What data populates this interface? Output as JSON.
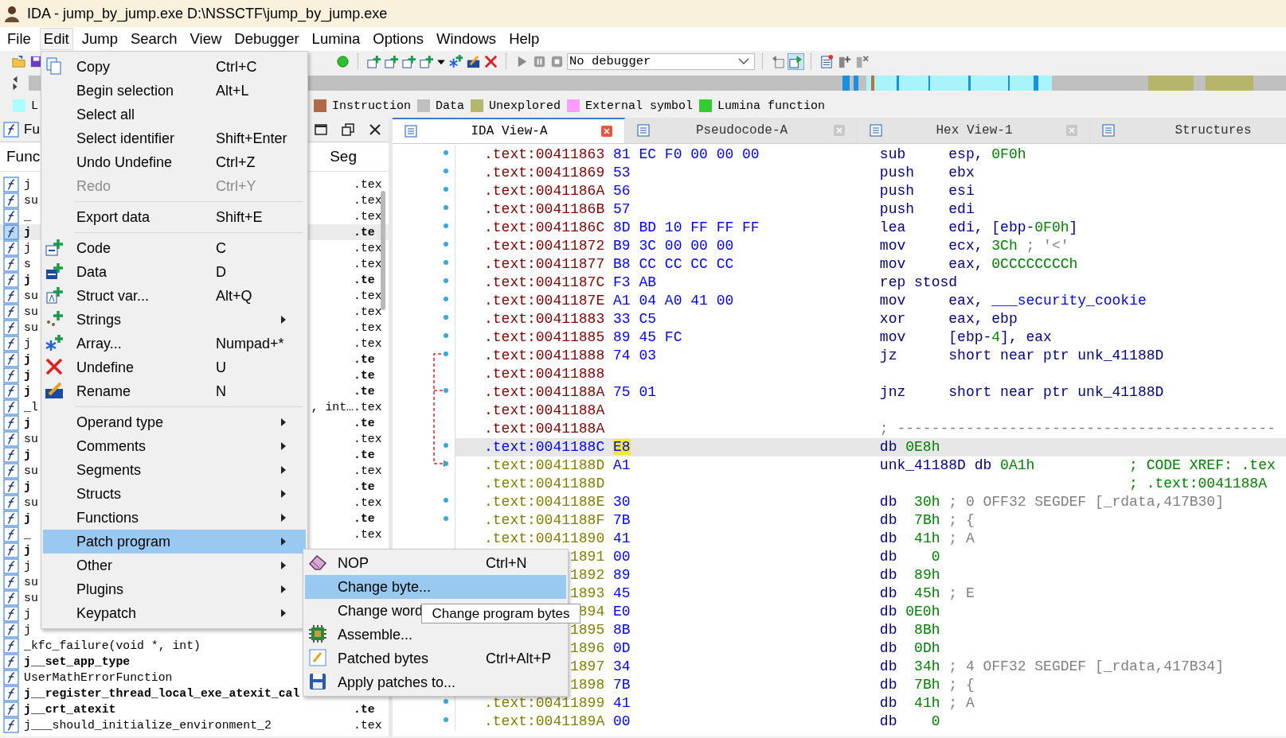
{
  "window": {
    "title": "IDA - jump_by_jump.exe D:\\NSSCTF\\jump_by_jump.exe"
  },
  "menu_bar": [
    {
      "label": "File",
      "selected": false
    },
    {
      "label": "Edit",
      "selected": true
    },
    {
      "label": "Jump",
      "selected": false
    },
    {
      "label": "Search",
      "selected": false
    },
    {
      "label": "View",
      "selected": false
    },
    {
      "label": "Debugger",
      "selected": false
    },
    {
      "label": "Lumina",
      "selected": false
    },
    {
      "label": "Options",
      "selected": false
    },
    {
      "label": "Windows",
      "selected": false
    },
    {
      "label": "Help",
      "selected": false
    }
  ],
  "toolbar": {
    "debugger_select": "No debugger"
  },
  "legend": [
    {
      "label": "L",
      "color": "#aaffff"
    },
    {
      "label": "Instruction",
      "color": "#b06a4a"
    },
    {
      "label": "Data",
      "color": "#c0c0c0"
    },
    {
      "label": "Unexplored",
      "color": "#b5b56c"
    },
    {
      "label": "External symbol",
      "color": "#ff9eff"
    },
    {
      "label": "Lumina function",
      "color": "#33cc33"
    }
  ],
  "functions_panel": {
    "title": "Fu",
    "columns": [
      "Func",
      "Seg"
    ],
    "rows": [
      {
        "name": "j",
        "bold": false,
        "selected": false,
        "segment": ".tex"
      },
      {
        "name": "su",
        "bold": false,
        "selected": false,
        "segment": ".tex"
      },
      {
        "name": "_",
        "selected": false,
        "segment": ".tex"
      },
      {
        "name": "j",
        "bold": true,
        "selected": true,
        "segment": ".te"
      },
      {
        "name": "j",
        "bold": false,
        "selected": false,
        "segment": ".tex"
      },
      {
        "name": "s",
        "bold": false,
        "selected": false,
        "segment": ".tex"
      },
      {
        "name": "j",
        "bold": true,
        "selected": false,
        "segment": ".te"
      },
      {
        "name": "su",
        "bold": false,
        "selected": false,
        "segment": ".tex"
      },
      {
        "name": "su",
        "bold": false,
        "selected": false,
        "segment": ".tex"
      },
      {
        "name": "su",
        "bold": false,
        "selected": false,
        "segment": ".tex"
      },
      {
        "name": "j",
        "bold": false,
        "selected": false,
        "segment": ".tex"
      },
      {
        "name": "j",
        "bold": true,
        "selected": false,
        "segment": ".te"
      },
      {
        "name": "j",
        "bold": true,
        "selected": false,
        "segment": ".te"
      },
      {
        "name": "j",
        "bold": true,
        "selected": false,
        "segment": ".te"
      },
      {
        "name": "_l",
        "bold": false,
        "selected": false,
        "tail": ", int…",
        "segment": ".tex"
      },
      {
        "name": "j",
        "bold": true,
        "selected": false,
        "segment": ".te"
      },
      {
        "name": "su",
        "bold": false,
        "selected": false,
        "segment": ".tex"
      },
      {
        "name": "j",
        "bold": true,
        "selected": false,
        "segment": ".te"
      },
      {
        "name": "su",
        "bold": false,
        "selected": false,
        "segment": ".tex"
      },
      {
        "name": "j",
        "bold": true,
        "selected": false,
        "segment": ".te"
      },
      {
        "name": "su",
        "bold": false,
        "selected": false,
        "segment": ".tex"
      },
      {
        "name": "j",
        "bold": true,
        "selected": false,
        "segment": ".te"
      },
      {
        "name": "_",
        "selected": false,
        "segment": ".tex"
      },
      {
        "name": "j",
        "bold": true,
        "selected": false
      },
      {
        "name": "j",
        "bold": false,
        "selected": false
      },
      {
        "name": "su",
        "bold": false,
        "selected": false
      },
      {
        "name": "su",
        "bold": false,
        "selected": false
      },
      {
        "name": "j",
        "bold": false,
        "selected": false
      },
      {
        "name": "j",
        "bold": false,
        "selected": false
      },
      {
        "name": "_kfc_failure(void *, int)",
        "bold": false,
        "selected": false
      },
      {
        "name": "j__set_app_type",
        "bold": true,
        "selected": false
      },
      {
        "name": "UserMathErrorFunction",
        "bold": false,
        "selected": false
      },
      {
        "name": "j__register_thread_local_exe_atexit_cal",
        "bold": true,
        "selected": false
      },
      {
        "name": "j__crt_atexit",
        "bold": true,
        "selected": false,
        "segment": ".te"
      },
      {
        "name": "j___should_initialize_environment_2",
        "bold": false,
        "selected": false,
        "segment": ".tex"
      }
    ]
  },
  "disassembly": {
    "tabs": [
      {
        "label": "IDA View-A",
        "selected": true
      },
      {
        "label": "Pseudocode-A",
        "selected": false
      },
      {
        "label": "Hex View-1",
        "selected": false
      },
      {
        "label": "Structures",
        "selected": false
      }
    ],
    "rows": [
      {
        "address": ".text:00411863",
        "kind": "code",
        "marked": true,
        "selected": false,
        "bytes": "81 EC F0 00 00 00",
        "code": [
          {
            "text": "sub     esp, ",
            "kind": "plain"
          },
          {
            "text": "0F0h",
            "kind": "num"
          }
        ]
      },
      {
        "address": ".text:00411869",
        "kind": "code",
        "marked": true,
        "selected": false,
        "bytes": "53",
        "code": [
          {
            "text": "push    ebx",
            "kind": "plain"
          }
        ]
      },
      {
        "address": ".text:0041186A",
        "kind": "code",
        "marked": true,
        "selected": false,
        "bytes": "56",
        "code": [
          {
            "text": "push    esi",
            "kind": "plain"
          }
        ]
      },
      {
        "address": ".text:0041186B",
        "kind": "code",
        "marked": true,
        "selected": false,
        "bytes": "57",
        "code": [
          {
            "text": "push    edi",
            "kind": "plain"
          }
        ]
      },
      {
        "address": ".text:0041186C",
        "kind": "code",
        "marked": true,
        "selected": false,
        "bytes": "8D BD 10 FF FF FF",
        "code": [
          {
            "text": "lea     edi, [ebp-",
            "kind": "plain"
          },
          {
            "text": "0F0h",
            "kind": "num"
          },
          {
            "text": "]",
            "kind": "plain"
          }
        ]
      },
      {
        "address": ".text:00411872",
        "kind": "code",
        "marked": true,
        "selected": false,
        "bytes": "B9 3C 00 00 00",
        "code": [
          {
            "text": "mov     ecx, ",
            "kind": "plain"
          },
          {
            "text": "3Ch",
            "kind": "num"
          },
          {
            "text": " ; '<'",
            "kind": "cmt"
          }
        ]
      },
      {
        "address": ".text:00411877",
        "kind": "code",
        "marked": true,
        "selected": false,
        "bytes": "B8 CC CC CC CC",
        "code": [
          {
            "text": "mov     eax, ",
            "kind": "plain"
          },
          {
            "text": "0CCCCCCCCh",
            "kind": "num"
          }
        ]
      },
      {
        "address": ".text:0041187C",
        "kind": "code",
        "marked": true,
        "selected": false,
        "bytes": "F3 AB",
        "code": [
          {
            "text": "rep stosd",
            "kind": "plain"
          }
        ]
      },
      {
        "address": ".text:0041187E",
        "kind": "code",
        "marked": true,
        "selected": false,
        "bytes": "A1 04 A0 41 00",
        "code": [
          {
            "text": "mov     eax, ",
            "kind": "plain"
          },
          {
            "text": "___security_cookie",
            "kind": "sym"
          }
        ]
      },
      {
        "address": ".text:00411883",
        "kind": "code",
        "marked": true,
        "selected": false,
        "bytes": "33 C5",
        "code": [
          {
            "text": "xor     eax, ebp",
            "kind": "plain"
          }
        ]
      },
      {
        "address": ".text:00411885",
        "kind": "code",
        "marked": true,
        "selected": false,
        "bytes": "89 45 FC",
        "code": [
          {
            "text": "mov     [ebp-",
            "kind": "plain"
          },
          {
            "text": "4",
            "kind": "num"
          },
          {
            "text": "], eax",
            "kind": "plain"
          }
        ]
      },
      {
        "address": ".text:00411888",
        "kind": "code",
        "marked": true,
        "selected": false,
        "bytes": "74 03",
        "code": [
          {
            "text": "jz      short near ptr unk_41188D",
            "kind": "plain"
          }
        ]
      },
      {
        "address": ".text:00411888",
        "kind": "code",
        "marked": false,
        "selected": false
      },
      {
        "address": ".text:0041188A",
        "kind": "code",
        "marked": true,
        "selected": false,
        "bytes": "75 01",
        "code": [
          {
            "text": "jnz     short near ptr unk_41188D",
            "kind": "plain"
          }
        ]
      },
      {
        "address": ".text:0041188A",
        "kind": "code",
        "marked": false,
        "selected": false
      },
      {
        "address": ".text:0041188A",
        "kind": "code",
        "marked": false,
        "selected": false,
        "code": [
          {
            "text": "; --------------------------------------------",
            "kind": "cmt"
          }
        ]
      },
      {
        "address": ".text:0041188C",
        "kind": "data",
        "marked": true,
        "selected": true,
        "bytes": "E8",
        "code": [
          {
            "text": "db ",
            "kind": "plain"
          },
          {
            "text": "0E8h",
            "kind": "num"
          }
        ]
      },
      {
        "address": ".text:0041188D",
        "kind": "data",
        "marked": true,
        "selected": false,
        "bytes": "A1",
        "code": [
          {
            "text": "unk_41188D db ",
            "kind": "plain"
          },
          {
            "text": "0A1h",
            "kind": "num"
          }
        ],
        "xref": "; CODE XREF: .tex"
      },
      {
        "address": ".text:0041188D",
        "kind": "data",
        "marked": false,
        "selected": false,
        "xref": "; .text:0041188A"
      },
      {
        "address": ".text:0041188E",
        "kind": "data",
        "marked": true,
        "selected": false,
        "bytes": "30",
        "code": [
          {
            "text": "db  ",
            "kind": "plain"
          },
          {
            "text": "30h",
            "kind": "num"
          },
          {
            "text": " ; 0 OFF32 SEGDEF [_rdata,417B30]",
            "kind": "cmt"
          }
        ]
      },
      {
        "address": ".text:0041188F",
        "kind": "data",
        "marked": true,
        "selected": false,
        "bytes": "7B",
        "code": [
          {
            "text": "db  ",
            "kind": "plain"
          },
          {
            "text": "7Bh",
            "kind": "num"
          },
          {
            "text": " ; {",
            "kind": "cmt"
          }
        ]
      },
      {
        "address": ".text:00411890",
        "kind": "data",
        "marked": false,
        "selected": false,
        "bytes": "41",
        "code": [
          {
            "text": "db  ",
            "kind": "plain"
          },
          {
            "text": "41h",
            "kind": "num"
          },
          {
            "text": " ; A",
            "kind": "cmt"
          }
        ]
      },
      {
        "address": "1891",
        "kind": "data",
        "marked": false,
        "selected": false,
        "bytes": "00",
        "code": [
          {
            "text": "db    ",
            "kind": "plain"
          },
          {
            "text": "0",
            "kind": "num"
          }
        ]
      },
      {
        "address": "1892",
        "kind": "data",
        "marked": false,
        "selected": false,
        "bytes": "89",
        "code": [
          {
            "text": "db  ",
            "kind": "plain"
          },
          {
            "text": "89h",
            "kind": "num"
          }
        ]
      },
      {
        "address": "1893",
        "kind": "data",
        "marked": false,
        "selected": false,
        "bytes": "45",
        "code": [
          {
            "text": "db  ",
            "kind": "plain"
          },
          {
            "text": "45h",
            "kind": "num"
          },
          {
            "text": " ; E",
            "kind": "cmt"
          }
        ]
      },
      {
        "address": "894",
        "kind": "data",
        "marked": false,
        "selected": false,
        "bytes": "E0",
        "code": [
          {
            "text": "db ",
            "kind": "plain"
          },
          {
            "text": "0E0h",
            "kind": "num"
          }
        ]
      },
      {
        "address": "1895",
        "kind": "data",
        "marked": false,
        "selected": false,
        "bytes": "8B",
        "code": [
          {
            "text": "db  ",
            "kind": "plain"
          },
          {
            "text": "8Bh",
            "kind": "num"
          }
        ]
      },
      {
        "address": "1896",
        "kind": "data",
        "marked": false,
        "selected": false,
        "bytes": "0D",
        "code": [
          {
            "text": "db  ",
            "kind": "plain"
          },
          {
            "text": "0Dh",
            "kind": "num"
          }
        ]
      },
      {
        "address": "1897",
        "kind": "data",
        "marked": false,
        "selected": false,
        "bytes": "34",
        "code": [
          {
            "text": "db  ",
            "kind": "plain"
          },
          {
            "text": "34h",
            "kind": "num"
          },
          {
            "text": " ; 4 OFF32 SEGDEF [_rdata,417B34]",
            "kind": "cmt"
          }
        ]
      },
      {
        "address": "1898",
        "kind": "data",
        "marked": false,
        "selected": false,
        "bytes": "7B",
        "code": [
          {
            "text": "db  ",
            "kind": "plain"
          },
          {
            "text": "7Bh",
            "kind": "num"
          },
          {
            "text": " ; {",
            "kind": "cmt"
          }
        ]
      },
      {
        "address": ".text:00411899",
        "kind": "data",
        "marked": true,
        "selected": false,
        "bytes": "41",
        "code": [
          {
            "text": "db  ",
            "kind": "plain"
          },
          {
            "text": "41h",
            "kind": "num"
          },
          {
            "text": " ; A",
            "kind": "cmt"
          }
        ]
      },
      {
        "address": ".text:0041189A",
        "kind": "data",
        "marked": true,
        "selected": false,
        "bytes": "00",
        "code": [
          {
            "text": "db    ",
            "kind": "plain"
          },
          {
            "text": "0",
            "kind": "num"
          }
        ]
      }
    ]
  },
  "edit_menu": {
    "items": [
      {
        "kind": "item",
        "label": "Copy",
        "shortcut": "Ctrl+C",
        "submenu": false,
        "disabled": false,
        "selected": false
      },
      {
        "kind": "item",
        "label": "Begin selection",
        "shortcut": "Alt+L",
        "submenu": false,
        "disabled": false,
        "selected": false
      },
      {
        "kind": "item",
        "label": "Select all",
        "submenu": false,
        "disabled": false,
        "selected": false
      },
      {
        "kind": "item",
        "label": "Select identifier",
        "shortcut": "Shift+Enter",
        "submenu": false,
        "disabled": false,
        "selected": false
      },
      {
        "kind": "item",
        "label": "Undo Undefine",
        "shortcut": "Ctrl+Z",
        "submenu": false,
        "disabled": false,
        "selected": false
      },
      {
        "kind": "item",
        "label": "Redo",
        "shortcut": "Ctrl+Y",
        "submenu": false,
        "disabled": true,
        "selected": false
      },
      {
        "kind": "separator"
      },
      {
        "kind": "item",
        "label": "Export data",
        "shortcut": "Shift+E",
        "submenu": false,
        "disabled": false,
        "selected": false
      },
      {
        "kind": "separator"
      },
      {
        "kind": "item",
        "label": "Code",
        "shortcut": "C",
        "submenu": false,
        "disabled": false,
        "selected": false
      },
      {
        "kind": "item",
        "label": "Data",
        "shortcut": "D",
        "submenu": false,
        "disabled": false,
        "selected": false
      },
      {
        "kind": "item",
        "label": "Struct var...",
        "shortcut": "Alt+Q",
        "submenu": false,
        "disabled": false,
        "selected": false
      },
      {
        "kind": "item",
        "label": "Strings",
        "submenu": true,
        "disabled": false,
        "selected": false
      },
      {
        "kind": "item",
        "label": "Array...",
        "shortcut": "Numpad+*",
        "submenu": false,
        "disabled": false,
        "selected": false
      },
      {
        "kind": "item",
        "label": "Undefine",
        "shortcut": "U",
        "submenu": false,
        "disabled": false,
        "selected": false
      },
      {
        "kind": "item",
        "label": "Rename",
        "shortcut": "N",
        "submenu": false,
        "disabled": false,
        "selected": false
      },
      {
        "kind": "separator"
      },
      {
        "kind": "item",
        "label": "Operand type",
        "submenu": true,
        "disabled": false,
        "selected": false
      },
      {
        "kind": "item",
        "label": "Comments",
        "submenu": true,
        "disabled": false,
        "selected": false
      },
      {
        "kind": "item",
        "label": "Segments",
        "submenu": true,
        "disabled": false,
        "selected": false
      },
      {
        "kind": "item",
        "label": "Structs",
        "submenu": true,
        "disabled": false,
        "selected": false
      },
      {
        "kind": "item",
        "label": "Functions",
        "submenu": true,
        "disabled": false,
        "selected": false
      },
      {
        "kind": "item",
        "label": "Patch program",
        "submenu": true,
        "disabled": false,
        "selected": true
      },
      {
        "kind": "item",
        "label": "Other",
        "submenu": true,
        "disabled": false,
        "selected": false
      },
      {
        "kind": "item",
        "label": "Plugins",
        "submenu": true,
        "disabled": false,
        "selected": false
      },
      {
        "kind": "item",
        "label": "Keypatch",
        "submenu": true,
        "disabled": false,
        "selected": false
      }
    ]
  },
  "patch_submenu": {
    "items": [
      {
        "label": "NOP",
        "shortcut": "Ctrl+N",
        "selected": false
      },
      {
        "label": "Change byte...",
        "selected": true
      },
      {
        "label": "Change word",
        "selected": false
      },
      {
        "label": "Assemble...",
        "selected": false
      },
      {
        "label": "Patched bytes",
        "shortcut": "Ctrl+Alt+P",
        "selected": false
      },
      {
        "label": "Apply patches to...",
        "selected": false
      }
    ]
  },
  "tooltip": "Change program bytes"
}
